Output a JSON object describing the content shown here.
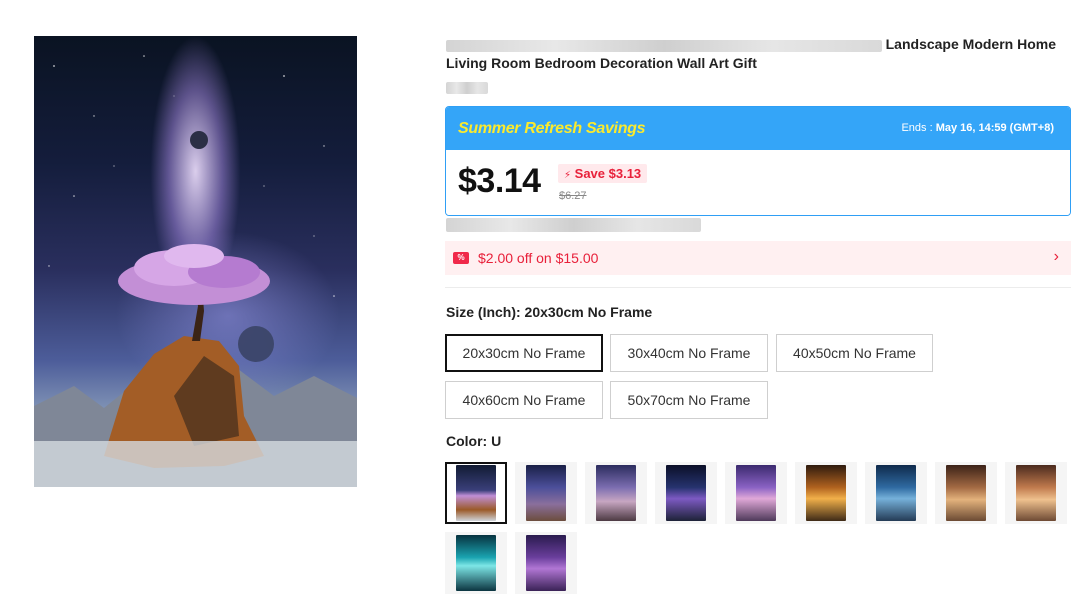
{
  "product": {
    "title_visible_part": "Landscape Modern Home",
    "title_line2": "Living Room Bedroom Decoration Wall Art Gift"
  },
  "promo": {
    "title": "Summer Refresh Savings",
    "ends_label": "Ends :",
    "ends_value": "May 16, 14:59 (GMT+8)",
    "price": "$3.14",
    "save": "Save $3.13",
    "original_price": "$6.27"
  },
  "coupon": {
    "icon": "coupon-ticket-icon",
    "text": "$2.00 off on $15.00",
    "arrow": "›"
  },
  "size": {
    "label": "Size (Inch): 20x30cm No Frame",
    "options": [
      "20x30cm No Frame",
      "30x40cm No Frame",
      "40x50cm No Frame",
      "40x60cm No Frame",
      "50x70cm No Frame"
    ],
    "selected": "20x30cm No Frame"
  },
  "color": {
    "label": "Color: U",
    "swatch_count_row1": 9,
    "swatch_count_row2": 2
  },
  "colors": {
    "promo_blue": "#34a5f8",
    "promo_title_yellow": "#fbea2d",
    "sale_red": "#e8203a",
    "coupon_bg": "#fff0f1"
  }
}
